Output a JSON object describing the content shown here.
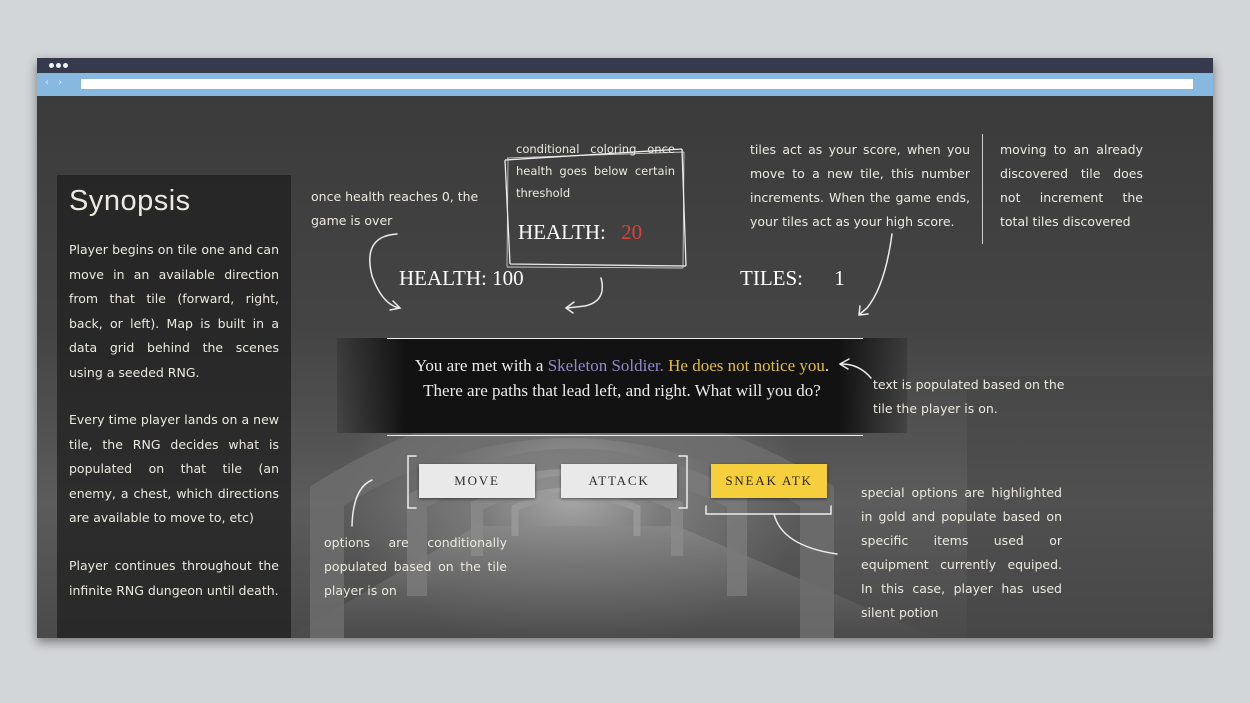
{
  "window": {
    "address_nav": "‹ ›"
  },
  "synopsis": {
    "title": "Synopsis",
    "paragraphs": [
      "Player begins on tile one and can move in an available direction from that tile (forward, right, back, or left). Map is built in a data grid behind the scenes using a seeded RNG.",
      "Every time player lands on a new tile, the RNG decides what is populated on that tile (an enemy, a chest, which directions are available to move to, etc)",
      "Player continues throughout the infinite RNG dungeon until death."
    ]
  },
  "notes": {
    "health_zero": "once health reaches 0, the game is over",
    "conditional_coloring": "conditional coloring once health goes below certain threshold",
    "tiles_score": "tiles act as your score, when you move to a new tile, this number increments. When the game ends, your tiles act as your high score.",
    "already_discovered": "moving to an already discovered tile does not increment the total tiles discovered",
    "text_populated": "text is populated based on the tile the player is on.",
    "options_conditional": "options are conditionally populated based on the tile player is on",
    "special_options": "special options are highlighted in gold and populate based on specific items used or equipment currently equiped. In this case, player has used silent potion"
  },
  "low_health_example": {
    "label": "HEALTH:",
    "value": "20",
    "color": "#d8423a"
  },
  "hud": {
    "health_label": "HEALTH:",
    "health_value": "100",
    "tiles_label": "TILES:",
    "tiles_value": "1"
  },
  "story": {
    "part1": "You are met with a ",
    "enemy": "Skeleton Soldier.",
    "part2": "  ",
    "highlight1": "He does not notice",
    "highlight2": "you",
    "part3": ". There are paths that lead left, and right. What will you do?"
  },
  "actions": {
    "move": "MOVE",
    "attack": "ATTACK",
    "sneak_attack": "SNEAK ATK"
  },
  "colors": {
    "enemy_name": "#8f8ac8",
    "highlight": "#e3bd3d",
    "special_button": "#f5cf3c",
    "danger": "#d8423a"
  }
}
